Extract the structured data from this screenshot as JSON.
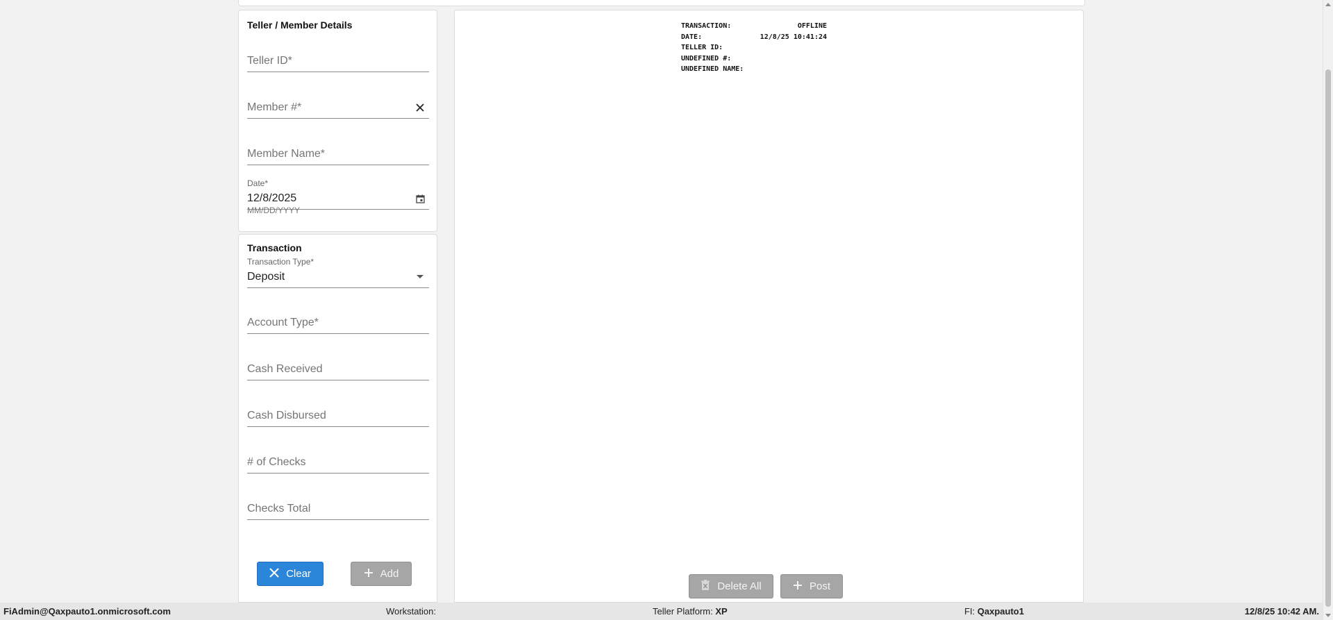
{
  "teller_panel": {
    "title": "Teller / Member Details",
    "teller_id_placeholder": "Teller ID*",
    "member_number_placeholder": "Member #*",
    "member_name_placeholder": "Member Name*",
    "date_label": "Date*",
    "date_value": "12/8/2025",
    "date_helper": "MM/DD/YYYY"
  },
  "transaction_panel": {
    "title": "Transaction",
    "transaction_type_label": "Transaction Type*",
    "transaction_type_value": "Deposit",
    "account_type_placeholder": "Account Type*",
    "cash_received_placeholder": "Cash Received",
    "cash_disbursed_placeholder": "Cash Disbursed",
    "num_checks_placeholder": "# of Checks",
    "checks_total_placeholder": "Checks Total",
    "clear_label": "Clear",
    "add_label": "Add"
  },
  "receipt": {
    "rows": [
      {
        "label": "TRANSACTION:",
        "value": "OFFLINE"
      },
      {
        "label": "DATE:",
        "value": "12/8/25 10:41:24"
      },
      {
        "label": "TELLER ID:",
        "value": ""
      },
      {
        "label": "UNDEFINED #:",
        "value": ""
      },
      {
        "label": "UNDEFINED NAME:",
        "value": ""
      }
    ],
    "delete_all_label": "Delete All",
    "post_label": "Post"
  },
  "status_bar": {
    "user": "FiAdmin@Qaxpauto1.onmicrosoft.com",
    "workstation_label": "Workstation:",
    "workstation_value": "",
    "platform_label": "Teller Platform:",
    "platform_value": "XP",
    "fi_label": "FI:",
    "fi_value": "Qaxpauto1",
    "datetime": "12/8/25 10:42 AM."
  },
  "colors": {
    "primary_button": "#2b86d9",
    "disabled_button": "#a6a6a6",
    "background": "#f2f2f2"
  },
  "icons": [
    "close-icon",
    "calendar-icon",
    "dropdown-arrow-icon",
    "x-icon",
    "plus-icon",
    "trash-icon"
  ]
}
